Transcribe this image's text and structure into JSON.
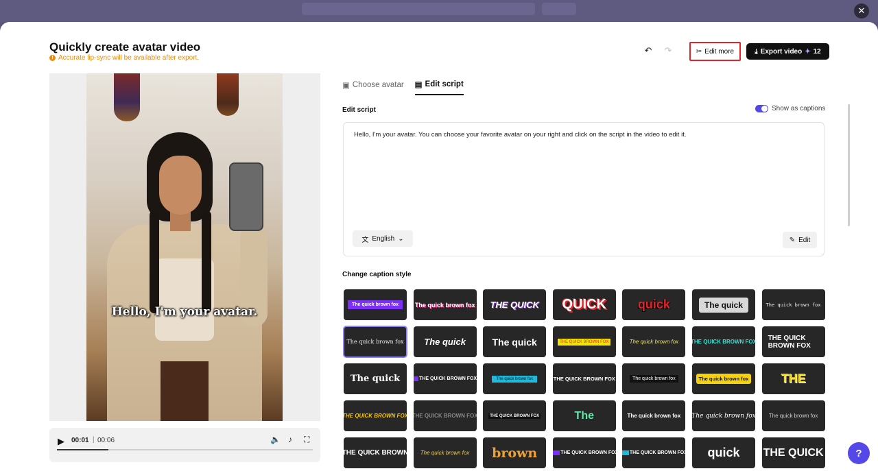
{
  "header": {
    "title": "Quickly create avatar video",
    "notice": "Accurate lip-sync will be available after export.",
    "edit_more_label": "Edit more",
    "export_label": "Export video",
    "export_credits": "12"
  },
  "preview": {
    "caption": "Hello, I'm your avatar.",
    "current_time": "00:01",
    "separator": "|",
    "total_time": "00:06",
    "progress": 0.2
  },
  "tabs": [
    {
      "label": "Choose avatar",
      "active": false
    },
    {
      "label": "Edit script",
      "active": true
    }
  ],
  "script": {
    "section_label": "Edit script",
    "show_captions_label": "Show as captions",
    "show_captions": true,
    "text": "Hello, I'm your avatar. You can choose your favorite avatar on your right and click on the script in the video to edit it.",
    "language": "English",
    "edit_label": "Edit"
  },
  "caption_styles": {
    "section_label": "Change caption style",
    "selected_index": 7,
    "items": [
      {
        "text": "The quick brown fox",
        "style": "font-size:7px;color:#fff;background:#7b2ff7;padding:3px 6px;font-weight:bold;"
      },
      {
        "text": "The quick brown fox",
        "style": "font-size:9px;color:#fff;font-weight:bold;text-shadow:1px 1px 0 #e0287a;"
      },
      {
        "text": "THE QUICK",
        "style": "font-size:13px;color:#fff;font-weight:bold;font-style:italic;text-shadow:1px 1px 0 #a24cf0;"
      },
      {
        "text": "QUICK",
        "style": "font-size:20px;color:#fff;font-weight:bold;text-shadow:2px 2px 0 #e3242b,-1px -1px 0 #e3242b;"
      },
      {
        "text": "quick",
        "style": "font-size:18px;color:#e3242b;font-weight:bold;text-shadow:1px 1px 0 #000,-1px 1px 0 #000;"
      },
      {
        "text": "The quick",
        "style": "font-size:12px;color:#111;background:#d8d8d8;padding:4px 8px;border-radius:3px;font-weight:bold;"
      },
      {
        "text": "The quick brown fox",
        "style": "font-size:7px;color:#eee;font-family:'DejaVu Sans Mono',monospace;"
      },
      {
        "text": "The quick brown fox",
        "style": "font-size:8px;color:#eee;font-family:'DejaVu Serif',serif;"
      },
      {
        "text": "The quick",
        "style": "font-size:13px;color:#fff;font-weight:bold;font-style:italic;"
      },
      {
        "text": "The quick",
        "style": "font-size:14px;color:#fff;font-weight:bold;"
      },
      {
        "text": "THE QUICK BROWN FOX",
        "style": "font-size:6px;color:#e3242b;background:#f5e20d;padding:2px 3px;"
      },
      {
        "text": "The quick brown fox",
        "style": "font-size:8px;color:#e8e26a;font-style:italic;"
      },
      {
        "text": "THE QUICK BROWN FOX",
        "style": "font-size:8px;color:#3ae0d4;font-weight:bold;"
      },
      {
        "text": "THE QUICK BROWN FOX",
        "style": "font-size:10px;color:#fff;font-weight:bold;white-space:normal;width:74px;line-height:11px;"
      },
      {
        "text": "The quick",
        "style": "font-size:13px;color:#fff;font-weight:bold;font-family:'DejaVu Serif',serif;"
      },
      {
        "text": "THE QUICK BROWN FOX",
        "style": "font-size:7px;color:#fff;font-weight:bold;border-left:8px solid #7b2ff7;padding-left:1px;"
      },
      {
        "text": "The quick brown fox",
        "style": "font-size:6px;color:#111;background:#22b8d8;padding:2px 6px;"
      },
      {
        "text": "THE QUICK BROWN FOX",
        "style": "font-size:7.5px;color:#fff;font-weight:bold;"
      },
      {
        "text": "The quick brown fox",
        "style": "font-size:7px;color:#fff;background:#111;padding:2px 4px;"
      },
      {
        "text": "The quick brown fox",
        "style": "font-size:7.5px;color:#111;background:#f5d20d;padding:3px 4px;border-radius:3px;font-weight:bold;"
      },
      {
        "text": "THE",
        "style": "font-size:18px;color:#f5d20d;font-weight:bold;text-shadow:1px 1px 0 #fff;"
      },
      {
        "text": "THE QUICK BROWN FOX",
        "style": "font-size:8px;color:#f5c50d;font-weight:bold;font-style:italic;"
      },
      {
        "text": "THE QUICK BROWN FOX",
        "style": "font-size:8px;color:#888;font-weight:bold;"
      },
      {
        "text": "THE QUICK BROWN FOX",
        "style": "font-size:6px;color:#fff;font-weight:bold;background:#111;padding:1px 2px;"
      },
      {
        "text": "The",
        "style": "font-size:16px;color:#5fe9a8;font-weight:bold;"
      },
      {
        "text": "The quick brown fox",
        "style": "font-size:8px;color:#fff;font-weight:bold;"
      },
      {
        "text": "The quick brown fox",
        "style": "font-size:9px;color:#fff;font-style:italic;font-family:'DejaVu Serif',serif;"
      },
      {
        "text": "The quick brown fox",
        "style": "font-size:8px;color:#ccc;"
      },
      {
        "text": "THE QUICK BROWN",
        "style": "font-size:10px;color:#fff;font-weight:bold;"
      },
      {
        "text": "The quick brown fox",
        "style": "font-size:8px;color:#e8d16a;font-style:italic;"
      },
      {
        "text": "brown",
        "style": "font-size:19px;color:#e8a23a;font-weight:bold;font-family:'DejaVu Serif',serif;"
      },
      {
        "text": "THE QUICK BROWN FOX",
        "style": "font-size:7px;color:#fff;font-weight:bold;border-left:14px solid #7b2ff7;padding-left:1px;"
      },
      {
        "text": "THE QUICK BROWN FOX",
        "style": "font-size:7px;color:#fff;font-weight:bold;border-left:12px solid #22b8d8;padding-left:1px;"
      },
      {
        "text": "quick",
        "style": "font-size:18px;color:#fff;font-weight:bold;"
      },
      {
        "text": "THE QUICK",
        "style": "font-size:16px;color:#fff;font-weight:bold;"
      }
    ]
  },
  "colors": {
    "accent": "#5448e8",
    "notice": "#ef8b0c",
    "highlight_border": "#e3242b"
  },
  "icons": [
    "close-icon",
    "warning-icon",
    "undo-icon",
    "redo-icon",
    "scissors-icon",
    "download-icon",
    "sparkle-icon",
    "play-icon",
    "volume-icon",
    "tiktok-icon",
    "fullscreen-icon",
    "avatar-tab-icon",
    "script-tab-icon",
    "translate-icon",
    "chevron-down-icon",
    "pencil-icon",
    "help-icon"
  ]
}
